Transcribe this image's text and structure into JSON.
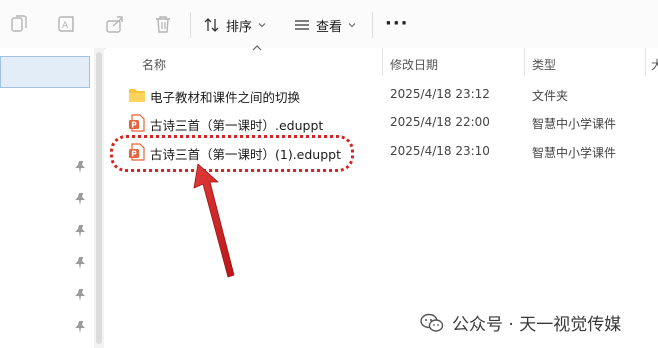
{
  "toolbar": {
    "sort_label": "排序",
    "view_label": "查看",
    "more_label": "···",
    "icons": [
      "copy-icon",
      "rename-icon",
      "share-icon",
      "delete-icon",
      "sort-icon",
      "view-icon"
    ]
  },
  "columns": {
    "name": "名称",
    "date": "修改日期",
    "type": "类型",
    "extra": "大"
  },
  "files": [
    {
      "name": "电子教材和课件之间的切换",
      "date": "2025/4/18 23:12",
      "type": "文件夹",
      "icon": "folder-icon"
    },
    {
      "name": "古诗三首（第一课时）.eduppt",
      "date": "2025/4/18 22:00",
      "type": "智慧中小学课件",
      "icon": "eduppt-file-icon"
    },
    {
      "name": "古诗三首（第一课时）(1).eduppt",
      "date": "2025/4/18 23:10",
      "type": "智慧中小学课件",
      "icon": "eduppt-file-icon"
    }
  ],
  "watermark": {
    "text": "公众号 · 天一视觉传媒"
  },
  "colors": {
    "highlight": "#d42424",
    "arrow": "#d42424",
    "folder": "#f5c542",
    "file_icon": "#e8623a",
    "selection": "#e3edf8"
  }
}
